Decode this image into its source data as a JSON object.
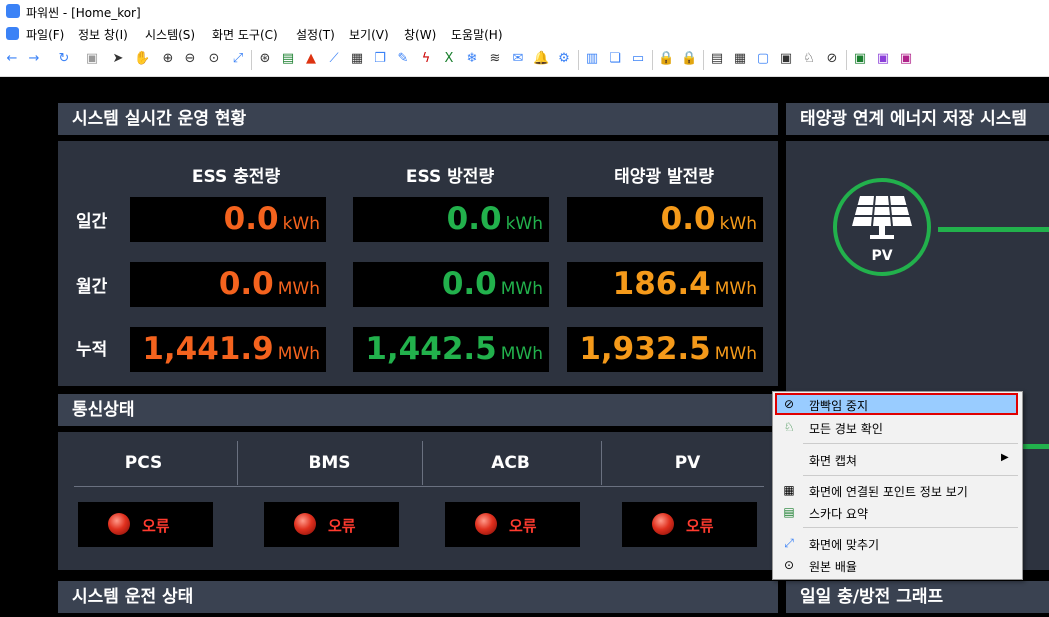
{
  "window": {
    "title": "파워씬 - [Home_kor]"
  },
  "menu": {
    "items": [
      "파일(F)",
      "정보 창(I)",
      "시스템(S)",
      "화면 도구(C)",
      "설정(T)",
      "보기(V)",
      "창(W)",
      "도움말(H)"
    ]
  },
  "toolbar": {
    "icons": [
      "back-arrow",
      "forward-arrow",
      "refresh",
      "disk",
      "pointer",
      "hand",
      "zoom-in",
      "zoom-out",
      "zoom-100",
      "fit-screen",
      "globe",
      "sheet",
      "alarm-triangle",
      "chart",
      "calendar",
      "copy",
      "note",
      "bolt",
      "excel",
      "snowflake",
      "layers",
      "mail",
      "bell",
      "gear",
      "panel",
      "windows",
      "monitor",
      "lock",
      "lock",
      "trend",
      "point-info",
      "comment",
      "badge",
      "alarm-check",
      "blink-stop",
      "green-window",
      "purple-window",
      "magenta-window"
    ]
  },
  "left_panel": {
    "title": "시스템 실시간 운영 현황",
    "columns": [
      "ESS 충전량",
      "ESS 방전량",
      "태양광 발전량"
    ],
    "rows": [
      {
        "label": "일간",
        "cells": [
          {
            "value": "0.0",
            "unit": "kWh"
          },
          {
            "value": "0.0",
            "unit": "kWh"
          },
          {
            "value": "0.0",
            "unit": "kWh"
          }
        ]
      },
      {
        "label": "월간",
        "cells": [
          {
            "value": "0.0",
            "unit": "MWh"
          },
          {
            "value": "0.0",
            "unit": "MWh"
          },
          {
            "value": "186.4",
            "unit": "MWh"
          }
        ]
      },
      {
        "label": "누적",
        "cells": [
          {
            "value": "1,441.9",
            "unit": "MWh"
          },
          {
            "value": "1,442.5",
            "unit": "MWh"
          },
          {
            "value": "1,932.5",
            "unit": "MWh"
          }
        ]
      }
    ]
  },
  "comm_panel": {
    "title": "통신상태",
    "devices": [
      {
        "name": "PCS",
        "status": "오류"
      },
      {
        "name": "BMS",
        "status": "오류"
      },
      {
        "name": "ACB",
        "status": "오류"
      },
      {
        "name": "PV",
        "status": "오류"
      }
    ]
  },
  "system_panel": {
    "title": "시스템 운전 상태"
  },
  "right_panel": {
    "title": "태양광 연계 에너지 저장 시스템",
    "pv_label": "PV"
  },
  "graph_panel": {
    "title": "일일 충/방전 그래프"
  },
  "context_menu": {
    "items": [
      {
        "label": "깜빡임 중지",
        "icon": "blink-stop-icon",
        "highlighted": true
      },
      {
        "label": "모든 경보 확인",
        "icon": "alarm-check-icon"
      },
      {
        "label": "화면 캡쳐",
        "icon": "",
        "submenu": true
      },
      {
        "label": "화면에 연결된 포인트 정보 보기",
        "icon": "point-info-icon"
      },
      {
        "label": "스카다 요약",
        "icon": "scada-summary-icon"
      },
      {
        "label": "화면에 맞추기",
        "icon": "fit-screen-icon"
      },
      {
        "label": "원본 배율",
        "icon": "original-zoom-icon"
      }
    ]
  },
  "colors": {
    "charge": "#f4631e",
    "discharge": "#22b14c",
    "solar": "#f59a1a",
    "error": "#ff3b2f",
    "pv_ring": "#22b14c",
    "highlight": "#99ccff",
    "highlight_border": "#e00000"
  }
}
